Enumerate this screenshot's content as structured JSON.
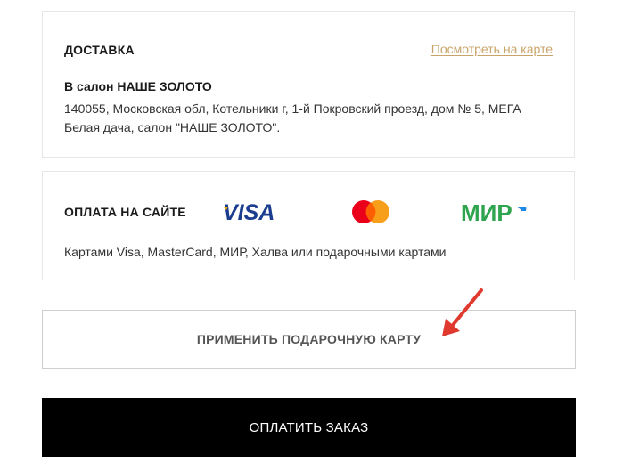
{
  "delivery": {
    "title": "ДОСТАВКА",
    "map_link": "Посмотреть на карте",
    "salon_name": "В салон НАШЕ ЗОЛОТО",
    "address": "140055, Московская обл, Котельники г, 1-й Покровский проезд, дом № 5, МЕГА Белая дача, салон \"НАШЕ ЗОЛОТО\"."
  },
  "payment": {
    "title": "ОПЛАТА НА САЙТЕ",
    "logos": [
      {
        "name": "visa-logo",
        "text": "VISA",
        "color": "#1a3d8f"
      },
      {
        "name": "mastercard-logo",
        "colors": [
          "#eb001b",
          "#f79e1b"
        ]
      },
      {
        "name": "mir-logo",
        "text": "МИР",
        "color": "#2ea44f"
      }
    ],
    "note": "Картами Visa, MasterCard, МИР, Халва или подарочными картами"
  },
  "gift_card": {
    "label": "ПРИМЕНИТЬ ПОДАРОЧНУЮ КАРТУ"
  },
  "checkout": {
    "label": "ОПЛАТИТЬ ЗАКАЗ"
  },
  "annotation": {
    "arrow_color": "#e03a2f"
  },
  "colors": {
    "link": "#c9a46a",
    "pay_button_bg": "#000000"
  }
}
